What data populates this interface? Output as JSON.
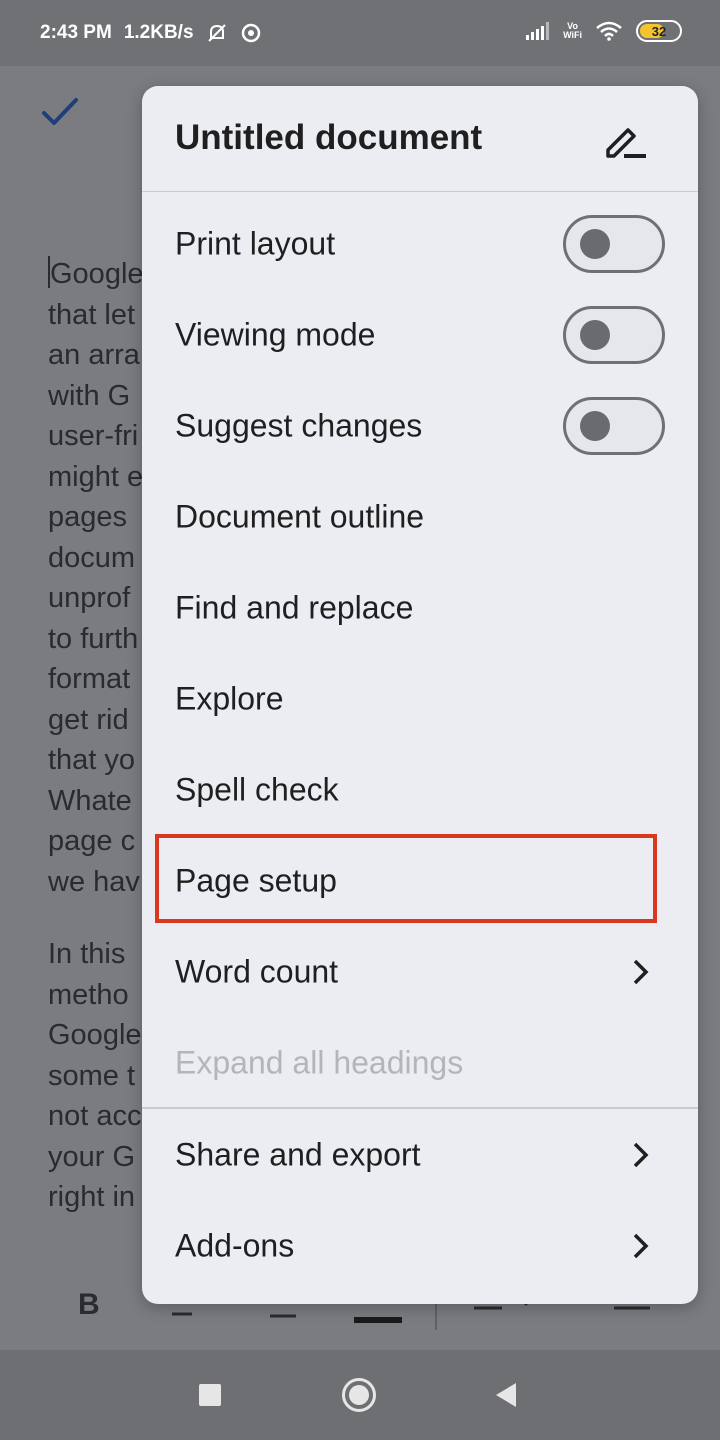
{
  "status_bar": {
    "time": "2:43 PM",
    "speed": "1.2KB/s",
    "vowifi_top": "Vo",
    "vowifi_bottom": "WiFi",
    "battery": "32",
    "icons": [
      "mute-bell-icon",
      "app-notification-icon",
      "signal-icon",
      "wifi-icon",
      "battery-icon"
    ]
  },
  "document": {
    "lines_para1": [
      "Google",
      "that let",
      "an arra",
      "with G",
      "user-fri",
      "might e",
      "pages",
      "docum",
      "unprof",
      "to furth",
      "format",
      "get rid",
      "that yo",
      "Whate",
      "page c",
      "we hav"
    ],
    "lines_para2": [
      "In this",
      "metho",
      "Google",
      "some t",
      "not acc",
      "your G",
      "right in"
    ]
  },
  "format_toolbar": {
    "bold": "B"
  },
  "menu": {
    "title": "Untitled document",
    "items": [
      {
        "label": "Print layout",
        "toggle": false
      },
      {
        "label": "Viewing mode",
        "toggle": false
      },
      {
        "label": "Suggest changes",
        "toggle": false
      },
      {
        "label": "Document outline"
      },
      {
        "label": "Find and replace"
      },
      {
        "label": "Explore"
      },
      {
        "label": "Spell check"
      },
      {
        "label": "Page setup",
        "highlighted": true
      },
      {
        "label": "Word count",
        "submenu": true
      },
      {
        "label": "Expand all headings",
        "disabled": true
      },
      {
        "label": "Share and export",
        "submenu": true
      },
      {
        "label": "Add-ons",
        "submenu": true
      }
    ]
  },
  "colors": {
    "highlight": "#d9381e",
    "menu_bg": "#ebedf2",
    "scrim": "#7a7c80"
  }
}
